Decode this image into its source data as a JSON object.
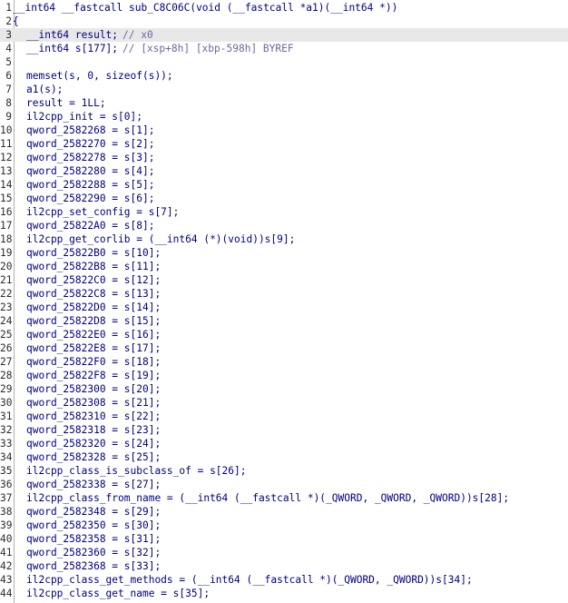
{
  "lines": [
    {
      "n": "1",
      "text": "__int64 __fastcall sub_C8C06C(void (__fastcall *a1)(__int64 *))",
      "comment": ""
    },
    {
      "n": "2",
      "text": "{",
      "comment": ""
    },
    {
      "n": "3",
      "text": "__int64 result;",
      "comment": "// x0"
    },
    {
      "n": "4",
      "text": "__int64 s[177];",
      "comment": "// [xsp+8h] [xbp-598h] BYREF"
    },
    {
      "n": "5",
      "text": "",
      "comment": ""
    },
    {
      "n": "6",
      "text": "memset(s, 0, sizeof(s));",
      "comment": ""
    },
    {
      "n": "7",
      "text": "a1(s);",
      "comment": ""
    },
    {
      "n": "8",
      "text": "result = 1LL;",
      "comment": ""
    },
    {
      "n": "9",
      "text": "il2cpp_init = s[0];",
      "comment": ""
    },
    {
      "n": "10",
      "text": "qword_2582268 = s[1];",
      "comment": ""
    },
    {
      "n": "11",
      "text": "qword_2582270 = s[2];",
      "comment": ""
    },
    {
      "n": "12",
      "text": "qword_2582278 = s[3];",
      "comment": ""
    },
    {
      "n": "13",
      "text": "qword_2582280 = s[4];",
      "comment": ""
    },
    {
      "n": "14",
      "text": "qword_2582288 = s[5];",
      "comment": ""
    },
    {
      "n": "15",
      "text": "qword_2582290 = s[6];",
      "comment": ""
    },
    {
      "n": "16",
      "text": "il2cpp_set_config = s[7];",
      "comment": ""
    },
    {
      "n": "17",
      "text": "qword_25822A0 = s[8];",
      "comment": ""
    },
    {
      "n": "18",
      "text": "il2cpp_get_corlib = (__int64 (*)(void))s[9];",
      "comment": ""
    },
    {
      "n": "19",
      "text": "qword_25822B0 = s[10];",
      "comment": ""
    },
    {
      "n": "20",
      "text": "qword_25822B8 = s[11];",
      "comment": ""
    },
    {
      "n": "21",
      "text": "qword_25822C0 = s[12];",
      "comment": ""
    },
    {
      "n": "22",
      "text": "qword_25822C8 = s[13];",
      "comment": ""
    },
    {
      "n": "23",
      "text": "qword_25822D0 = s[14];",
      "comment": ""
    },
    {
      "n": "24",
      "text": "qword_25822D8 = s[15];",
      "comment": ""
    },
    {
      "n": "25",
      "text": "qword_25822E0 = s[16];",
      "comment": ""
    },
    {
      "n": "26",
      "text": "qword_25822E8 = s[17];",
      "comment": ""
    },
    {
      "n": "27",
      "text": "qword_25822F0 = s[18];",
      "comment": ""
    },
    {
      "n": "28",
      "text": "qword_25822F8 = s[19];",
      "comment": ""
    },
    {
      "n": "29",
      "text": "qword_2582300 = s[20];",
      "comment": ""
    },
    {
      "n": "30",
      "text": "qword_2582308 = s[21];",
      "comment": ""
    },
    {
      "n": "31",
      "text": "qword_2582310 = s[22];",
      "comment": ""
    },
    {
      "n": "32",
      "text": "qword_2582318 = s[23];",
      "comment": ""
    },
    {
      "n": "33",
      "text": "qword_2582320 = s[24];",
      "comment": ""
    },
    {
      "n": "34",
      "text": "qword_2582328 = s[25];",
      "comment": ""
    },
    {
      "n": "35",
      "text": "il2cpp_class_is_subclass_of = s[26];",
      "comment": ""
    },
    {
      "n": "36",
      "text": "qword_2582338 = s[27];",
      "comment": ""
    },
    {
      "n": "37",
      "text": "il2cpp_class_from_name = (__int64 (__fastcall *)(_QWORD, _QWORD, _QWORD))s[28];",
      "comment": ""
    },
    {
      "n": "38",
      "text": "qword_2582348 = s[29];",
      "comment": ""
    },
    {
      "n": "39",
      "text": "qword_2582350 = s[30];",
      "comment": ""
    },
    {
      "n": "40",
      "text": "qword_2582358 = s[31];",
      "comment": ""
    },
    {
      "n": "41",
      "text": "qword_2582360 = s[32];",
      "comment": ""
    },
    {
      "n": "42",
      "text": "qword_2582368 = s[33];",
      "comment": ""
    },
    {
      "n": "43",
      "text": "il2cpp_class_get_methods = (__int64 (__fastcall *)(_QWORD, _QWORD))s[34];",
      "comment": ""
    },
    {
      "n": "44",
      "text": "il2cpp_class_get_name = s[35];",
      "comment": ""
    }
  ],
  "highlighted_line": "3",
  "colors": {
    "code": "#000080",
    "comment": "#6a6aa0",
    "highlight": "#e8e8e8",
    "gutter": "#b0b0b0"
  }
}
